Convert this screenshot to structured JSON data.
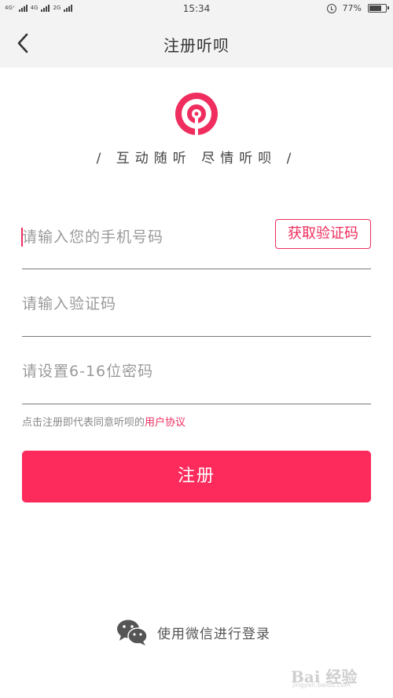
{
  "status_bar": {
    "network_1": "4G⁺",
    "network_2": "4G",
    "network_3": "2G",
    "time": "15:34",
    "battery": "77%",
    "battery_level": 0.77
  },
  "header": {
    "title": "注册听呗"
  },
  "brand": {
    "slogan": "/ 互动随听  尽情听呗 /",
    "accent_color": "#ef2d5e"
  },
  "form": {
    "phone_placeholder": "请输入您的手机号码",
    "get_code_label": "获取验证码",
    "code_placeholder": "请输入验证码",
    "password_placeholder": "请设置6-16位密码",
    "agreement_text": "点击注册即代表同意听呗的",
    "agreement_link": "用户协议",
    "register_label": "注册"
  },
  "social": {
    "wechat_label": "使用微信进行登录",
    "icon": "wechat-icon"
  },
  "watermark": {
    "text": "Bai 经验",
    "sub": "jingyan.baidu.com"
  }
}
